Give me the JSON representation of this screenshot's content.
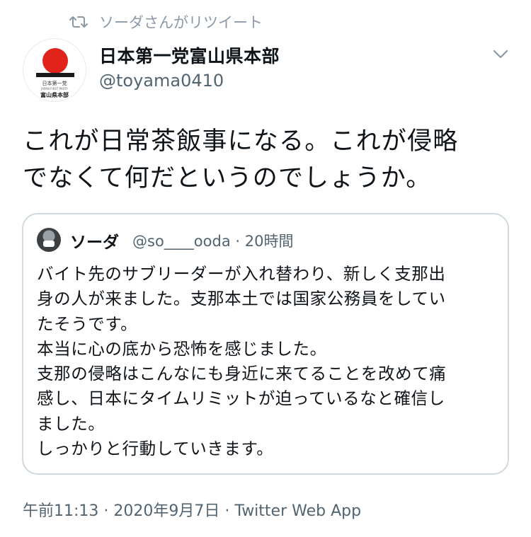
{
  "retweet": {
    "label": "ソーダさんがリツイート",
    "icon": "retweet-icon"
  },
  "author": {
    "name": "日本第一党富山県本部",
    "handle": "@toyama0410",
    "avatar_text_line1": "日本第一党",
    "avatar_text_line2": "JAPAN FIRST PARTY",
    "avatar_text_line3": "富山県本部"
  },
  "tweet": {
    "text": "これが日常茶飯事になる。これが侵略\nでなくて何だというのでしょうか。"
  },
  "quoted": {
    "name": "ソーダ",
    "handle": "@so____ooda",
    "separator": "·",
    "time": "20時間",
    "text": "バイト先のサブリーダーが入れ替わり、新しく支那出\n身の人が来ました。支那本土では国家公務員をしてい\nたそうです。\n本当に心の底から恐怖を感じました。\n支那の侵略はこんなにも身近に来てることを改めて痛\n感し、日本にタイムリミットが迫っているなと確信し\nました。\nしっかりと行動していきます。"
  },
  "footer": {
    "time": "午前11:13",
    "separator1": "·",
    "date": "2020年9月7日",
    "separator2": "·",
    "app": "Twitter Web App"
  },
  "colors": {
    "muted": "#536471",
    "border": "#cfd9de",
    "logo_red": "#e0241b"
  }
}
